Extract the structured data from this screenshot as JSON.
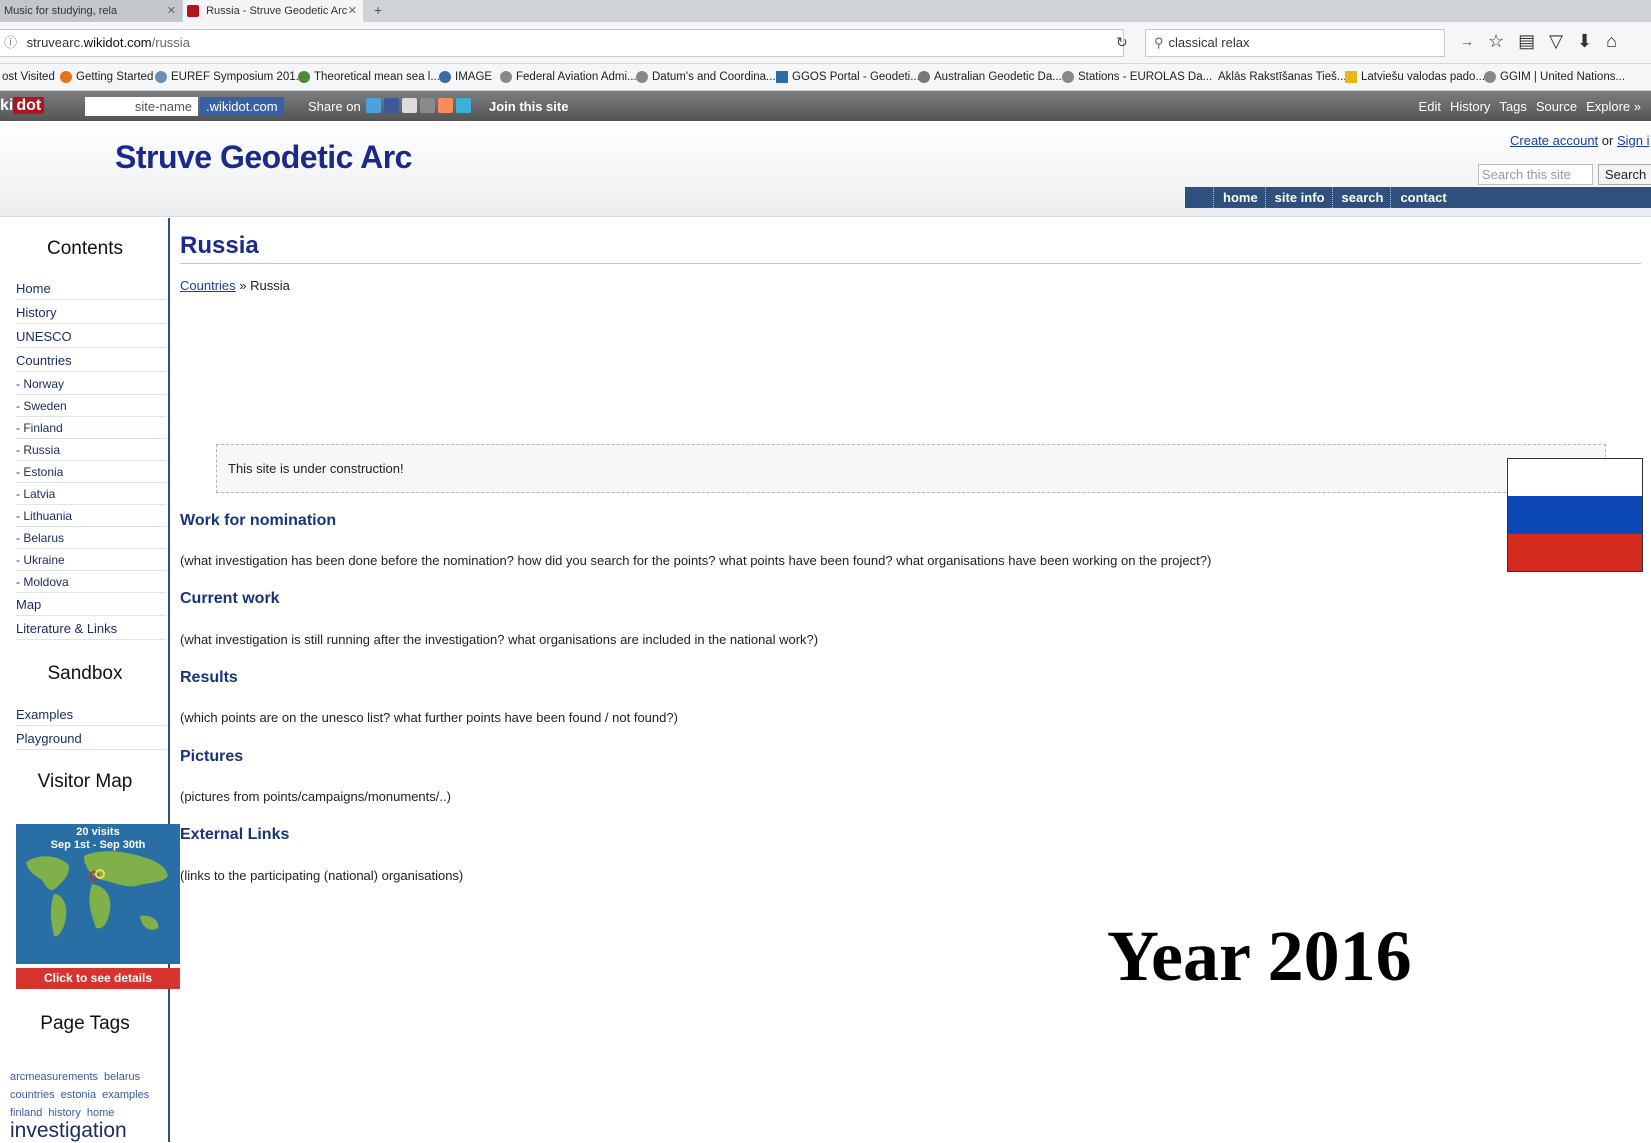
{
  "browser": {
    "tabs": [
      {
        "label": "Music for studying, rela",
        "active": false
      },
      {
        "label": "Russia - Struve Geodetic Arc",
        "active": true
      }
    ],
    "url": {
      "info_icon": "info-icon",
      "host_pre": "struvearc.",
      "host": "wikidot.com",
      "path": "/russia"
    },
    "search_query": "classical relax",
    "bookmarks": [
      "ost Visited",
      "Getting Started",
      "EUREF Symposium 201...",
      "Theoretical mean sea l...",
      "IMAGE",
      "Federal Aviation Admi...",
      "Datum's and Coordina...",
      "GGOS Portal - Geodeti...",
      "Australian Geodetic Da...",
      "Stations - EUROLAS Da...",
      "Aklās Rakstīšanas Tieš...",
      "Latviešu valodas pado...",
      "GGIM | United Nations..."
    ]
  },
  "wikidot_bar": {
    "logo": "ki",
    "logo_dot": "dot",
    "site_name_placeholder": "site-name",
    "domain": ".wikidot.com",
    "share_on": "Share on",
    "join": "Join this site",
    "actions": [
      "Edit",
      "History",
      "Tags",
      "Source",
      "Explore »"
    ]
  },
  "header": {
    "site_title": "Struve Geodetic Arc",
    "create_account": "Create account",
    "or": "or",
    "sign_in": "Sign i",
    "search_placeholder": "Search this site",
    "search_button": "Search",
    "nav": [
      "home",
      "site info",
      "search",
      "contact"
    ]
  },
  "sidebar": {
    "contents_title": "Contents",
    "links": [
      "Home",
      "History",
      "UNESCO",
      "Countries"
    ],
    "countries": [
      "- Norway",
      "- Sweden",
      "- Finland",
      "- Russia",
      "- Estonia",
      "- Latvia",
      "- Lithuania",
      "- Belarus",
      "- Ukraine",
      "- Moldova"
    ],
    "links2": [
      "Map",
      "Literature & Links"
    ],
    "sandbox_title": "Sandbox",
    "sandbox_links": [
      "Examples",
      "Playground"
    ],
    "visitor_map_title": "Visitor Map",
    "visitor_map_visits": "20 visits",
    "visitor_map_range": "Sep 1st - Sep 30th",
    "visitor_map_button": "Click to see details",
    "page_tags_title": "Page Tags",
    "tags": [
      "arcmeasurements",
      "belarus",
      "countries",
      "estonia",
      "examples",
      "finland",
      "history",
      "home"
    ],
    "tag_big": "investigation"
  },
  "main": {
    "title": "Russia",
    "breadcrumb_link": "Countries",
    "breadcrumb_rest": " » Russia",
    "construction_notice": "This site is under construction!",
    "sections": [
      {
        "heading": "Work for nomination",
        "text": "(what investigation has been done before the nomination? how did you search for the points? what points have been found? what organisations have been working on the project?)"
      },
      {
        "heading": "Current work",
        "text": "(what investigation is still running after the investigation? what organisations are included in the national work?)"
      },
      {
        "heading": "Results",
        "text": "(which points are on the unesco list? what further points have been found / not found?)"
      },
      {
        "heading": "Pictures",
        "text": "(pictures from points/campaigns/monuments/..)"
      },
      {
        "heading": "External Links",
        "text": "(links to the participating (national) organisations)"
      }
    ],
    "flag_colors": [
      "#ffffff",
      "#0c47b7",
      "#d52b1e"
    ],
    "overlay_year": "Year 2016"
  },
  "colors": {
    "accent": "#1a2a8a",
    "nav": "#2f4f7c",
    "link": "#1a3fa6"
  }
}
